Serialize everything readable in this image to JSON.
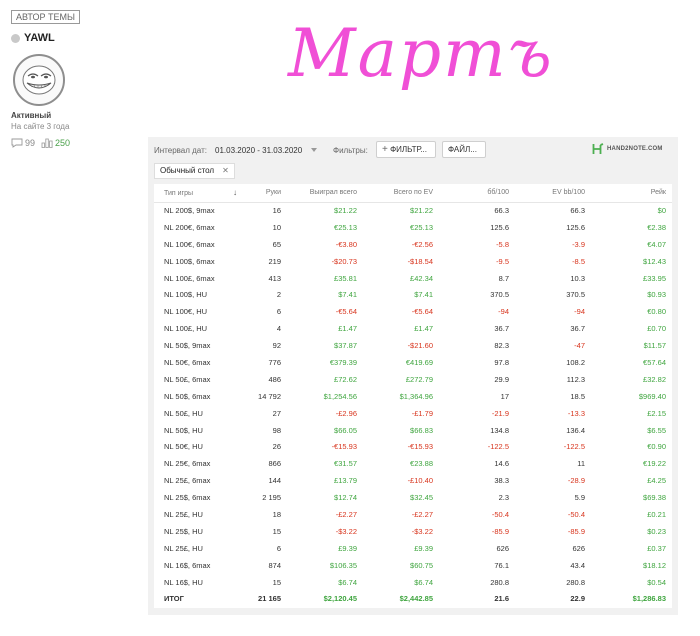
{
  "author": {
    "badge": "АВТОР ТЕМЫ",
    "name": "YAWL",
    "rank": "Активный",
    "online": "На сайте 3 года",
    "comments": "99",
    "rating": "250"
  },
  "heading": "Мартъ",
  "toolbar": {
    "interval_label": "Интервал дат:",
    "interval_value": "01.03.2020 - 31.03.2020",
    "filters_label": "Фильтры:",
    "filter_button": "ФИЛЬТР...",
    "files_button": "ФАЙЛ...",
    "logo_text": "HAND2NOTE.COM"
  },
  "tab": {
    "label": "Обычный стол",
    "close": "✕"
  },
  "colors": {
    "positive": "#3fa53f",
    "negative": "#d8351e",
    "heading": "#f04fd6",
    "logo": "#4caf50"
  },
  "table": {
    "headers": [
      "Тип игры",
      "Руки",
      "Выиграл всего",
      "Всего по EV",
      "бб/100",
      "EV bb/100",
      "Рейк"
    ],
    "rows": [
      [
        "NL 200$, 9max",
        "16",
        "$21.22",
        "$21.22",
        "66.3",
        "66.3",
        "$0"
      ],
      [
        "NL 200€, 6max",
        "10",
        "€25.13",
        "€25.13",
        "125.6",
        "125.6",
        "€2.38"
      ],
      [
        "NL 100€, 6max",
        "65",
        "-€3.80",
        "-€2.56",
        "-5.8",
        "-3.9",
        "€4.07"
      ],
      [
        "NL 100$, 6max",
        "219",
        "-$20.73",
        "-$18.54",
        "-9.5",
        "-8.5",
        "$12.43"
      ],
      [
        "NL 100£, 6max",
        "413",
        "£35.81",
        "£42.34",
        "8.7",
        "10.3",
        "£33.95"
      ],
      [
        "NL 100$, HU",
        "2",
        "$7.41",
        "$7.41",
        "370.5",
        "370.5",
        "$0.93"
      ],
      [
        "NL 100€, HU",
        "6",
        "-€5.64",
        "-€5.64",
        "-94",
        "-94",
        "€0.80"
      ],
      [
        "NL 100£, HU",
        "4",
        "£1.47",
        "£1.47",
        "36.7",
        "36.7",
        "£0.70"
      ],
      [
        "NL 50$, 9max",
        "92",
        "$37.87",
        "-$21.60",
        "82.3",
        "-47",
        "$11.57"
      ],
      [
        "NL 50€, 6max",
        "776",
        "€379.39",
        "€419.69",
        "97.8",
        "108.2",
        "€57.64"
      ],
      [
        "NL 50£, 6max",
        "486",
        "£72.62",
        "£272.79",
        "29.9",
        "112.3",
        "£32.82"
      ],
      [
        "NL 50$, 6max",
        "14 792",
        "$1,254.56",
        "$1,364.96",
        "17",
        "18.5",
        "$969.40"
      ],
      [
        "NL 50£, HU",
        "27",
        "-£2.96",
        "-£1.79",
        "-21.9",
        "-13.3",
        "£2.15"
      ],
      [
        "NL 50$, HU",
        "98",
        "$66.05",
        "$66.83",
        "134.8",
        "136.4",
        "$6.55"
      ],
      [
        "NL 50€, HU",
        "26",
        "-€15.93",
        "-€15.93",
        "-122.5",
        "-122.5",
        "€0.90"
      ],
      [
        "NL 25€, 6max",
        "866",
        "€31.57",
        "€23.88",
        "14.6",
        "11",
        "€19.22"
      ],
      [
        "NL 25£, 6max",
        "144",
        "£13.79",
        "-£10.40",
        "38.3",
        "-28.9",
        "£4.25"
      ],
      [
        "NL 25$, 6max",
        "2 195",
        "$12.74",
        "$32.45",
        "2.3",
        "5.9",
        "$69.38"
      ],
      [
        "NL 25£, HU",
        "18",
        "-£2.27",
        "-£2.27",
        "-50.4",
        "-50.4",
        "£0.21"
      ],
      [
        "NL 25$, HU",
        "15",
        "-$3.22",
        "-$3.22",
        "-85.9",
        "-85.9",
        "$0.23"
      ],
      [
        "NL 25£, HU",
        "6",
        "£9.39",
        "£9.39",
        "626",
        "626",
        "£0.37"
      ],
      [
        "NL 16$, 6max",
        "874",
        "$106.35",
        "$60.75",
        "76.1",
        "43.4",
        "$18.12"
      ],
      [
        "NL 16$, HU",
        "15",
        "$6.74",
        "$6.74",
        "280.8",
        "280.8",
        "$0.54"
      ]
    ],
    "total": [
      "ИТОГ",
      "21 165",
      "$2,120.45",
      "$2,442.85",
      "21.6",
      "22.9",
      "$1,286.83"
    ]
  }
}
